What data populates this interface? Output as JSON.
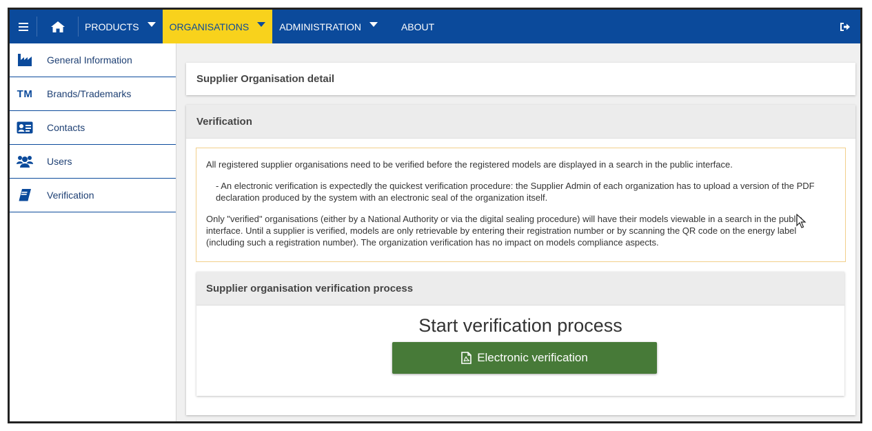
{
  "nav": {
    "products": "PRODUCTS",
    "organisations": "ORGANISATIONS",
    "administration": "ADMINISTRATION",
    "about": "ABOUT"
  },
  "sidebar": {
    "items": [
      {
        "label": "General Information",
        "icon": "industry-icon"
      },
      {
        "label": "Brands/Trademarks",
        "icon": "trademark-icon",
        "icon_text": "TM"
      },
      {
        "label": "Contacts",
        "icon": "contact-card-icon"
      },
      {
        "label": "Users",
        "icon": "users-icon"
      },
      {
        "label": "Verification",
        "icon": "book-icon"
      }
    ]
  },
  "detail": {
    "title": "Supplier Organisation detail"
  },
  "verification": {
    "title": "Verification",
    "notice": {
      "p1": "All registered supplier organisations need to be verified before the registered models are displayed in a search in the public interface.",
      "p2": "- An electronic verification is expectedly the quickest verification procedure: the Supplier Admin of each organization has to upload a version of the PDF declaration produced by the system with an electronic seal of the organization itself.",
      "p3": "Only \"verified\" organisations (either by a National Authority or via the digital sealing procedure) will have their models viewable in a search in the public interface. Until a supplier is verified, models are only retrievable by entering their registration number or by scanning the QR code on the energy label (including such a registration number). The organization verification has no impact on models compliance aspects."
    },
    "process": {
      "title": "Supplier organisation verification process",
      "heading": "Start verification process",
      "button_label": "Electronic verification"
    }
  },
  "colors": {
    "nav_bg": "#0b4a9b",
    "nav_active": "#f8d21c",
    "button_green": "#477a38",
    "notice_border": "#f2cf8a"
  }
}
